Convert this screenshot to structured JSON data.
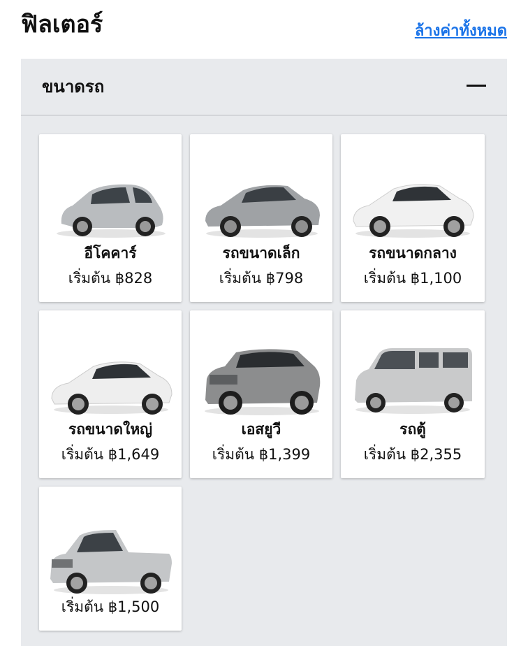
{
  "header": {
    "title": "ฟิลเตอร์",
    "clear_all": "ล้างค่าทั้งหมด"
  },
  "filter_section": {
    "title": "ขนาดรถ",
    "toggle_icon": "minus-icon",
    "cards": [
      {
        "name": "อีโคคาร์",
        "price": "เริ่มต้น ฿828",
        "car_color": "#b9bcbf"
      },
      {
        "name": "รถขนาดเล็ก",
        "price": "เริ่มต้น ฿798",
        "car_color": "#9fa2a5"
      },
      {
        "name": "รถขนาดกลาง",
        "price": "เริ่มต้น ฿1,100",
        "car_color": "#f1f1f1"
      },
      {
        "name": "รถขนาดใหญ่",
        "price": "เริ่มต้น ฿1,649",
        "car_color": "#eeeeee"
      },
      {
        "name": "เอสยูวี",
        "price": "เริ่มต้น ฿1,399",
        "car_color": "#8c8d8e"
      },
      {
        "name": "รถตู้",
        "price": "เริ่มต้น ฿2,355",
        "car_color": "#c9cacb"
      },
      {
        "name": "",
        "price": "เริ่มต้น ฿1,500",
        "car_color": "#c4c6c8"
      }
    ]
  },
  "colors": {
    "accent": "#1a73e8",
    "panel_bg": "#e8eaed"
  }
}
